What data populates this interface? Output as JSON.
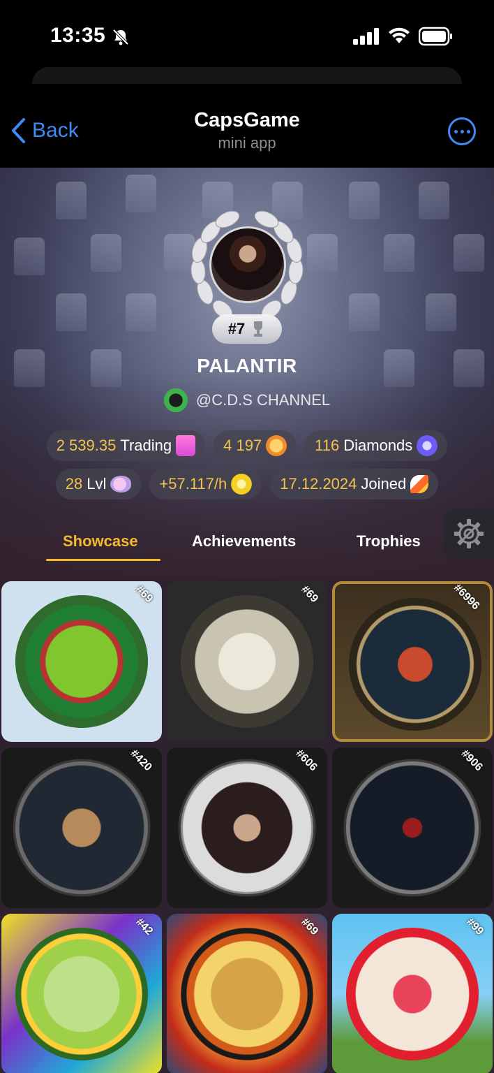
{
  "status_bar": {
    "time": "13:35"
  },
  "nav": {
    "back_label": "Back",
    "title": "CapsGame",
    "subtitle": "mini app"
  },
  "profile": {
    "rank": "#7",
    "username": "PALANTIR",
    "channel": "@C.D.S CHANNEL"
  },
  "stats_row1": [
    {
      "value": "2 539.35",
      "label": "Trading",
      "icon": "shopping-bag-icon"
    },
    {
      "value": "4 197",
      "label": "",
      "icon": "coin-stack-icon"
    },
    {
      "value": "116",
      "label": "Diamonds",
      "icon": "diamond-icon"
    }
  ],
  "stats_row2": [
    {
      "value": "28",
      "label": "Lvl",
      "icon": "piggy-icon"
    },
    {
      "value": "+57.117/h",
      "label": "",
      "icon": "coin-icon"
    },
    {
      "value": "17.12.2024",
      "label": "Joined",
      "icon": "rocket-icon"
    }
  ],
  "tabs": [
    {
      "label": "Showcase",
      "active": true
    },
    {
      "label": "Achievements",
      "active": false
    },
    {
      "label": "Trophies",
      "active": false
    }
  ],
  "showcase": [
    {
      "number": "#69"
    },
    {
      "number": "#69"
    },
    {
      "number": "#6996"
    },
    {
      "number": "#420"
    },
    {
      "number": "#606"
    },
    {
      "number": "#906"
    },
    {
      "number": "#42"
    },
    {
      "number": "#69"
    },
    {
      "number": "#99"
    }
  ],
  "colors": {
    "accent": "#f5b92e",
    "link": "#3e8bf5"
  }
}
